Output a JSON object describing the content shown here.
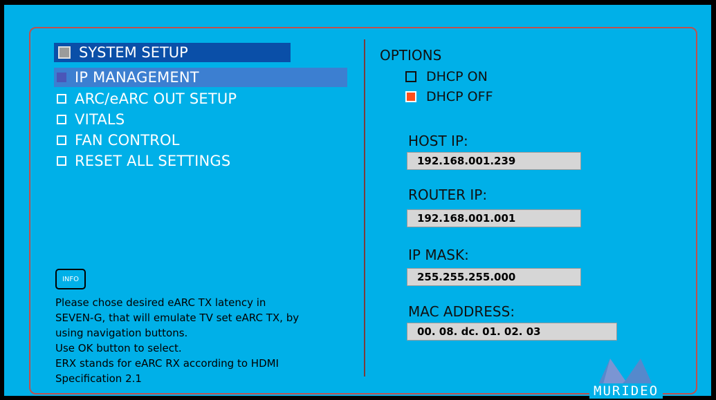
{
  "menu": {
    "header": "SYSTEM SETUP",
    "items": [
      {
        "label": "IP MANAGEMENT",
        "selected": true
      },
      {
        "label": "ARC/eARC OUT SETUP",
        "selected": false
      },
      {
        "label": "VITALS",
        "selected": false
      },
      {
        "label": "FAN CONTROL",
        "selected": false
      },
      {
        "label": "RESET ALL SETTINGS",
        "selected": false
      }
    ]
  },
  "options": {
    "title": "OPTIONS",
    "dhcp_on": "DHCP ON",
    "dhcp_off": "DHCP OFF",
    "checked": "DHCP OFF"
  },
  "fields": {
    "host_ip_label": "HOST IP:",
    "host_ip": "192.168.001.239",
    "router_ip_label": "ROUTER IP:",
    "router_ip": "192.168.001.001",
    "ip_mask_label": "IP MASK:",
    "ip_mask": "255.255.255.000",
    "mac_label": "MAC ADDRESS:",
    "mac": "00. 08. dc. 01. 02. 03"
  },
  "info": {
    "button_label": "INFO",
    "lines": [
      "Please chose desired eARC TX latency in",
      "SEVEN-G, that will emulate TV set eARC TX, by",
      "using navigation buttons.",
      "Use OK button to select.",
      "ERX stands for eARC RX according to HDMI",
      "Specification 2.1"
    ]
  },
  "logo": {
    "text": "MURIDEO"
  },
  "colors": {
    "background": "#00b0e8",
    "frame_border": "#c0504d",
    "header_bar": "#0a4fa8",
    "selection_bar": "#3c7fd1",
    "checked_box": "#ff4f1a",
    "field_bg": "#d6d6d6"
  }
}
